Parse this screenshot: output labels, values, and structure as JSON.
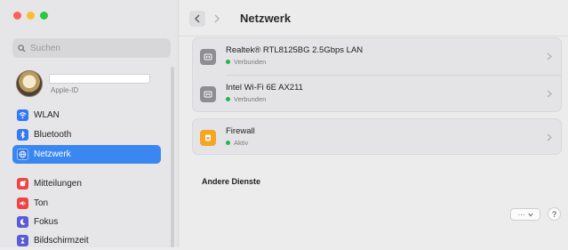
{
  "window": {
    "traffic_colors": {
      "close": "#ff5f57",
      "minimize": "#febc2e",
      "zoom": "#28c840"
    }
  },
  "search": {
    "placeholder": "Suchen",
    "value": ""
  },
  "account": {
    "subtitle": "Apple-ID"
  },
  "sidebar": {
    "items": [
      {
        "label": "WLAN",
        "icon": "wifi-icon",
        "color": "#3478f6",
        "active": false
      },
      {
        "label": "Bluetooth",
        "icon": "bluetooth-icon",
        "color": "#3478f6",
        "active": false
      },
      {
        "label": "Netzwerk",
        "icon": "globe-icon",
        "color": "#3478f6",
        "active": true
      },
      {
        "label": "Mitteilungen",
        "icon": "bell-icon",
        "color": "#ef4444",
        "active": false
      },
      {
        "label": "Ton",
        "icon": "speaker-icon",
        "color": "#ef4444",
        "active": false
      },
      {
        "label": "Fokus",
        "icon": "moon-icon",
        "color": "#5b5bd6",
        "active": false
      },
      {
        "label": "Bildschirmzeit",
        "icon": "hourglass-icon",
        "color": "#5b5bd6",
        "active": false
      }
    ],
    "accent": "#3b87f2"
  },
  "header": {
    "title": "Netzwerk"
  },
  "services": [
    {
      "title": "Realtek® RTL8125BG 2.5Gbps LAN",
      "status": "Verbunden",
      "icon": "ethernet-icon"
    },
    {
      "title": "Intel Wi-Fi 6E AX211",
      "status": "Verbunden",
      "icon": "ethernet-icon"
    }
  ],
  "firewall": {
    "title": "Firewall",
    "status": "Aktiv",
    "icon": "firewall-icon"
  },
  "other_services": {
    "heading": "Andere Dienste"
  },
  "footer": {
    "more_label": "···",
    "help_label": "?"
  },
  "status_color": "#2bb34a"
}
